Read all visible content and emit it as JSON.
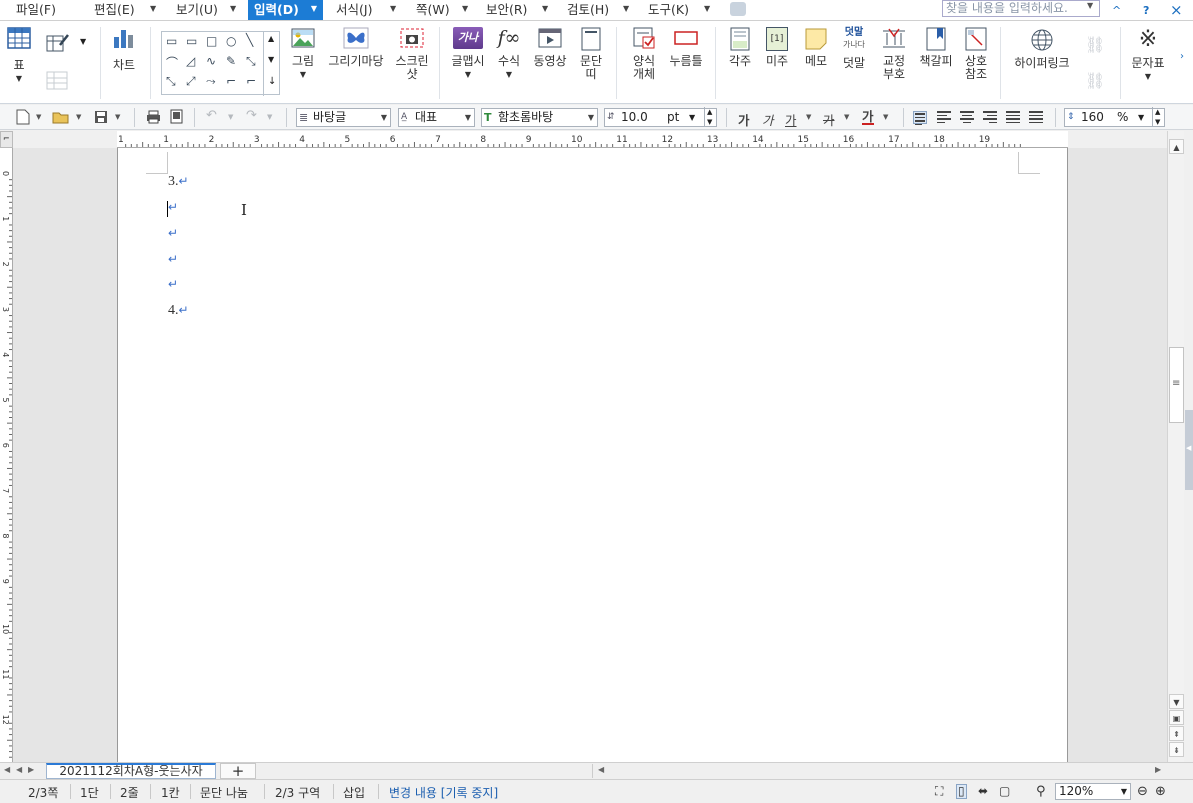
{
  "menu": {
    "items": [
      "파일(F)",
      "편집(E)",
      "보기(U)",
      "입력(D)",
      "서식(J)",
      "쪽(W)",
      "보안(R)",
      "검토(H)",
      "도구(K)"
    ],
    "active_index": 3,
    "search_placeholder": "찾을 내용을 입력하세요.",
    "window_controls": [
      "^",
      "?",
      "×"
    ]
  },
  "ribbon": {
    "table": "표",
    "chart": "차트",
    "picture": "그림",
    "draw_art": "그리기마당",
    "screenshot_line1": "스크린",
    "screenshot_line2": "샷",
    "wordart": "글맵시",
    "equation": "수식",
    "video": "동영상",
    "paragraph_line1": "문단",
    "paragraph_line2": "띠",
    "form_line1": "양식",
    "form_line2": "개체",
    "stamp": "누름틀",
    "footnote": "각주",
    "endnote": "미주",
    "memo": "메모",
    "overlap": "덧말",
    "overlap_icon_line1": "덧말",
    "overlap_icon_line2": "가나다",
    "proof_line1": "교정",
    "proof_line2": "부호",
    "bookmark": "책갈피",
    "crossref_line1": "상호",
    "crossref_line2": "참조",
    "hyperlink": "하이퍼링크",
    "symbols": "문자표",
    "wordart_icon": "가나다",
    "endnote_icon": "[1]",
    "equation_icon": "f∞"
  },
  "toolbar": {
    "style": "바탕글",
    "style_icon": "≣",
    "language": "대표",
    "font": "함초롬바탕",
    "font_icon": "T",
    "font_size": "10.0",
    "font_unit": "pt",
    "line_spacing": "160",
    "line_spacing_unit": "%",
    "bold": "가",
    "italic": "가",
    "underline": "가",
    "strike": "가",
    "color": "가"
  },
  "ruler": {
    "h_numbers": [
      "1",
      "1",
      "2",
      "3",
      "4",
      "5",
      "6",
      "7",
      "8",
      "9",
      "10",
      "11",
      "12",
      "13",
      "14",
      "15",
      "16",
      "17",
      "18",
      "19"
    ],
    "v_numbers": [
      "0",
      "1",
      "2",
      "3",
      "4",
      "5",
      "6",
      "7",
      "8",
      "9",
      "10",
      "11",
      "12"
    ]
  },
  "document": {
    "lines": [
      "3.",
      "",
      "",
      "",
      "",
      "4."
    ],
    "para_mark": "↵"
  },
  "tabs": {
    "doc_name": "2021112회차A형-웃는사자",
    "add": "+"
  },
  "status": {
    "page": "2/3쪽",
    "column": "1단",
    "line": "2줄",
    "col_pos": "1칸",
    "break": "문단 나눔",
    "section": "2/3 구역",
    "mode": "삽입",
    "track": "변경 내용 [기록 중지]",
    "zoom": "120%"
  }
}
